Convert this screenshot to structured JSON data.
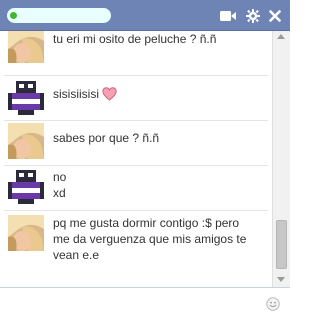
{
  "title_bar": {
    "contact_name": "",
    "icons": [
      "video-call-icon",
      "gear-icon",
      "close-icon"
    ],
    "background_color": "#6d84b4"
  },
  "messages": [
    {
      "sender": "contact",
      "avatar": "blonde-girl-avatar",
      "lines": [
        "tu eri mi osito de peluche ? ñ.ñ"
      ]
    },
    {
      "sender": "self",
      "avatar": "robot-purple-avatar",
      "lines": [
        "sisisiisisi"
      ],
      "emoji": "heart-icon"
    },
    {
      "sender": "contact",
      "avatar": "blonde-girl-avatar",
      "lines": [
        "sabes por que ? ñ.ñ"
      ]
    },
    {
      "sender": "self",
      "avatar": "robot-purple-avatar",
      "lines": [
        "no",
        "xd"
      ]
    },
    {
      "sender": "contact",
      "avatar": "blonde-girl-avatar",
      "lines": [
        "pq me gusta dormir contigo :$ pero",
        "me da verguenza que mis amigos te",
        "vean e.e"
      ]
    }
  ],
  "composer": {
    "placeholder": "",
    "value": "",
    "emoji_button_icon": "smiley-icon"
  }
}
